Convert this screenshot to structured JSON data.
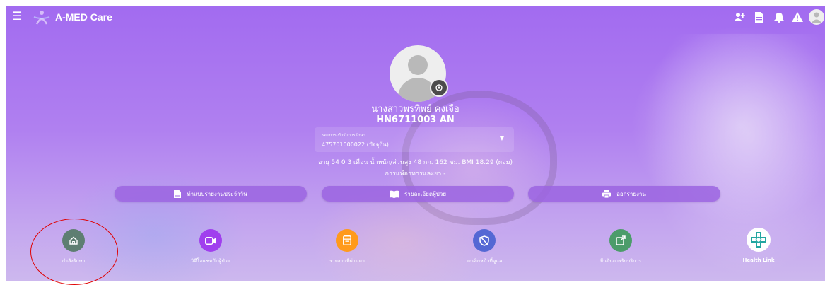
{
  "app": {
    "title": "A-MED Care",
    "brand_color": "#a66cf0"
  },
  "header": {
    "menu_icon": "☰",
    "icons": [
      "add-user-icon",
      "document-icon",
      "bell-icon",
      "warning-icon",
      "user-avatar-icon"
    ]
  },
  "patient": {
    "name": "นางสาวพรทิพย์ คงเจือ",
    "hn": "HN6711003 AN",
    "admission_label": "รอบการเข้ารับการรักษา",
    "admission_value": "475701000022 (ปัจจุบัน)",
    "info_line": "อายุ 54 0 3 เดือน น้ำหนัก/ส่วนสูง 48 กก. 162 ซม. BMI 18.29 (ผอม)",
    "allergy_line": "การแพ้อาหารและยา -"
  },
  "actions": [
    {
      "label": "ทำแบบรายงานประจำวัน",
      "icon": "document-icon"
    },
    {
      "label": "รายละเอียดผู้ป่วย",
      "icon": "book-icon"
    },
    {
      "label": "ออกรายงาน",
      "icon": "printer-icon"
    }
  ],
  "nav": [
    {
      "label": "กำลังรักษา",
      "icon": "home-icon",
      "color": "#5e7e72"
    },
    {
      "label": "วิดีโอแชทกับผู้ป่วย",
      "icon": "video-icon",
      "color": "#a03fee"
    },
    {
      "label": "รายงานที่ผ่านมา",
      "icon": "archive-icon",
      "color": "#ff9a1c"
    },
    {
      "label": "ยกเลิกหน้าที่ดูแล",
      "icon": "shield-off-icon",
      "color": "#5468d4"
    },
    {
      "label": "ยืนยันการรับบริการ",
      "icon": "external-link-icon",
      "color": "#4c9c6a"
    },
    {
      "label": "Health Link",
      "icon": "health-link-icon",
      "color": "#ffffff"
    }
  ]
}
